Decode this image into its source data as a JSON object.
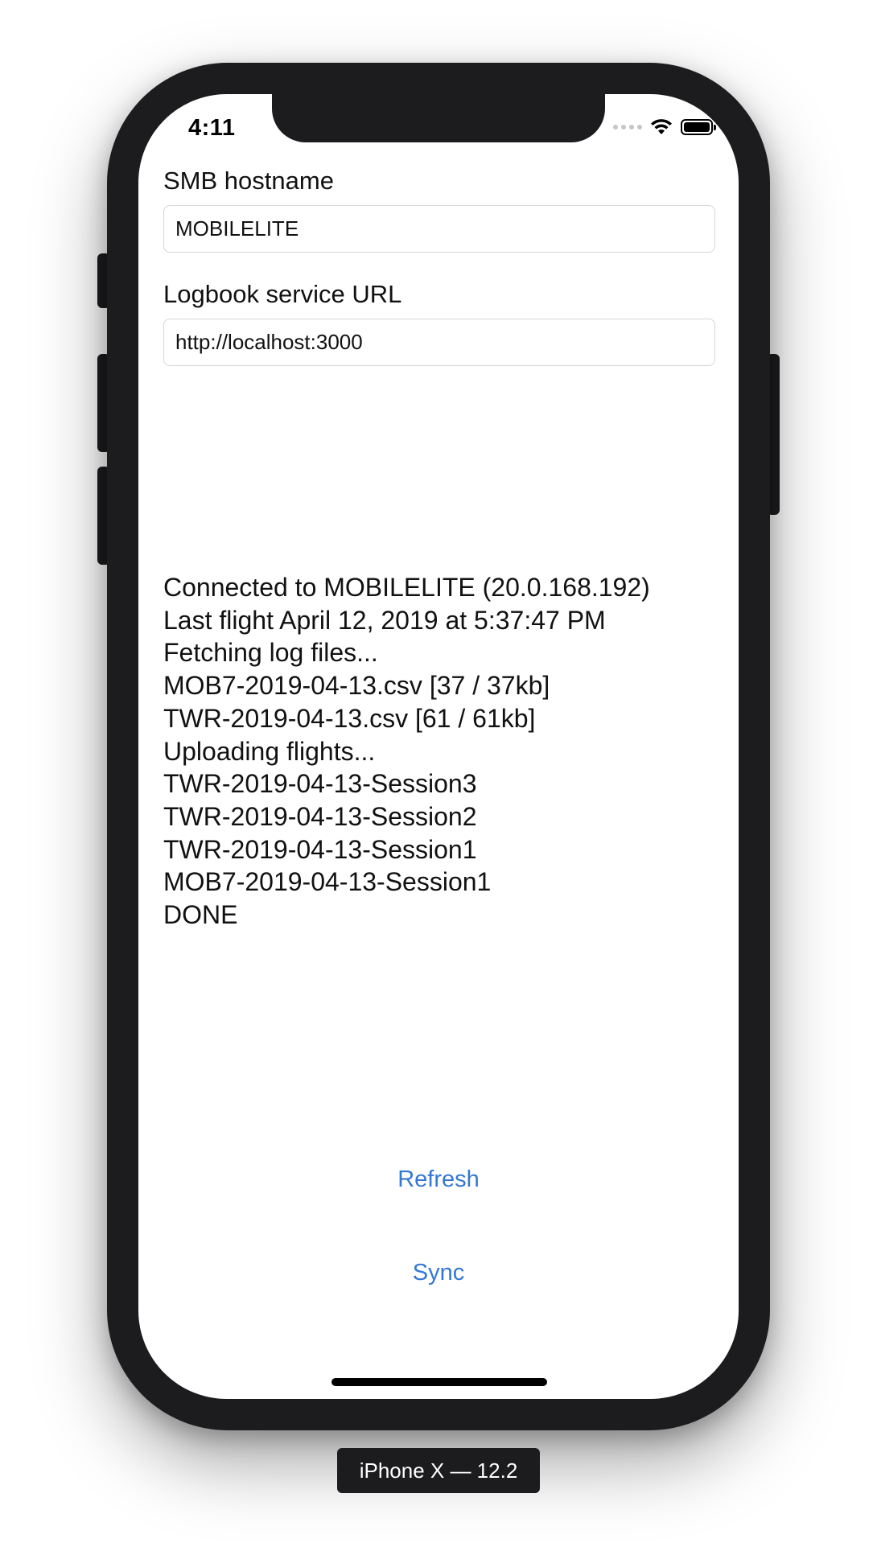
{
  "status_bar": {
    "time": "4:11",
    "icons": [
      "cellular-signal-icon",
      "wifi-icon",
      "battery-icon"
    ]
  },
  "form": {
    "smb_label": "SMB hostname",
    "smb_value": "MOBILELITE",
    "url_label": "Logbook service URL",
    "url_value": "http://localhost:3000"
  },
  "log": {
    "lines": [
      "Connected to MOBILELITE (20.0.168.192)",
      "Last flight April 12, 2019 at 5:37:47 PM",
      "Fetching log files...",
      "MOB7-2019-04-13.csv [37 / 37kb]",
      "TWR-2019-04-13.csv [61 / 61kb]",
      "Uploading flights...",
      "TWR-2019-04-13-Session3",
      "TWR-2019-04-13-Session2",
      "TWR-2019-04-13-Session1",
      "MOB7-2019-04-13-Session1",
      "DONE"
    ]
  },
  "actions": {
    "refresh_label": "Refresh",
    "sync_label": "Sync"
  },
  "simulator": {
    "device_label": "iPhone X — 12.2"
  },
  "colors": {
    "accent": "#3478d4",
    "device_frame": "#1c1c1e",
    "text": "#111111"
  }
}
